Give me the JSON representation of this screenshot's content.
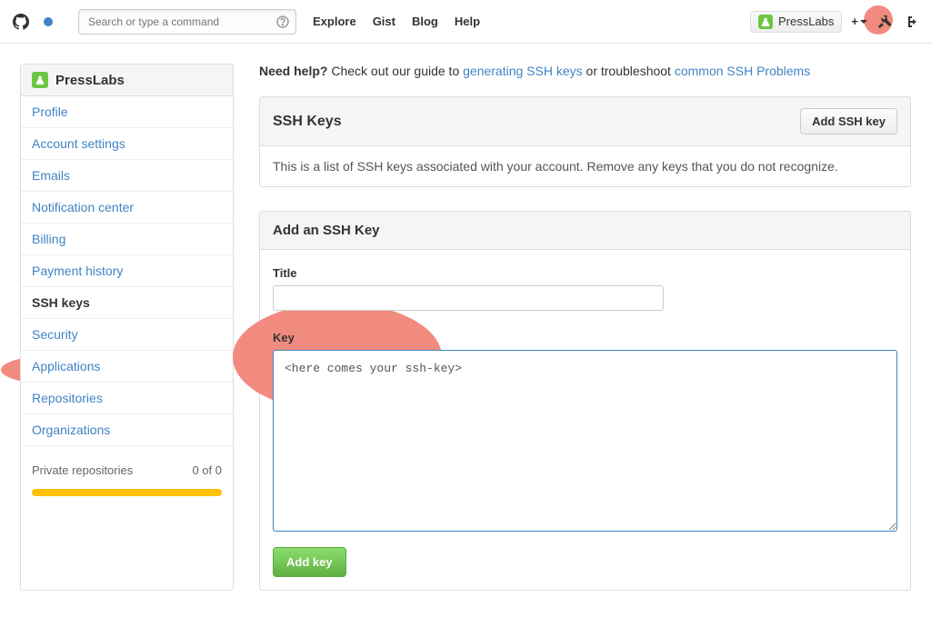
{
  "topbar": {
    "search_placeholder": "Search or type a command",
    "nav": {
      "explore": "Explore",
      "gist": "Gist",
      "blog": "Blog",
      "help": "Help"
    },
    "username": "PressLabs",
    "plus": "+"
  },
  "sidebar": {
    "title": "PressLabs",
    "items": [
      "Profile",
      "Account settings",
      "Emails",
      "Notification center",
      "Billing",
      "Payment history",
      "SSH keys",
      "Security",
      "Applications",
      "Repositories",
      "Organizations"
    ],
    "active_index": 6,
    "private_repos_label": "Private repositories",
    "private_repos_count": "0 of 0"
  },
  "help": {
    "prefix": "Need help?",
    "text1": " Check out our guide to ",
    "link1": "generating SSH keys",
    "text2": " or troubleshoot ",
    "link2": "common SSH Problems"
  },
  "ssh_panel": {
    "title": "SSH Keys",
    "add_btn": "Add SSH key",
    "desc": "This is a list of SSH keys associated with your account. Remove any keys that you do not recognize."
  },
  "form": {
    "title": "Add an SSH Key",
    "title_label": "Title",
    "title_value": "",
    "key_label": "Key",
    "key_value": "<here comes your ssh-key>",
    "submit": "Add key"
  }
}
